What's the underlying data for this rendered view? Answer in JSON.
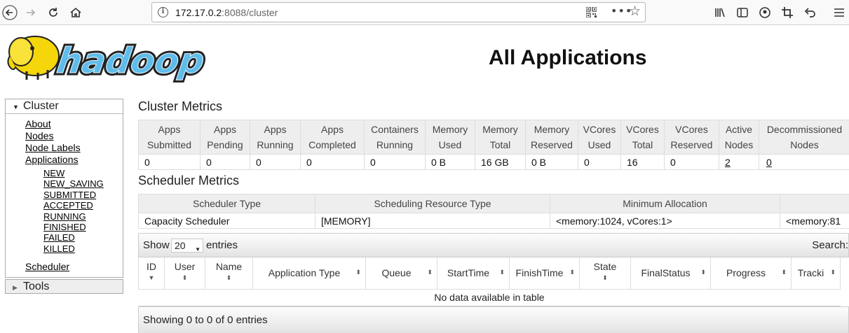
{
  "browser": {
    "url_host": "172.17.0.2",
    "url_rest": ":8088/cluster"
  },
  "page": {
    "title": "All Applications"
  },
  "sidebar": {
    "cluster_label": "Cluster",
    "links": [
      "About",
      "Nodes",
      "Node Labels",
      "Applications"
    ],
    "app_states": [
      "NEW",
      "NEW_SAVING",
      "SUBMITTED",
      "ACCEPTED",
      "RUNNING",
      "FINISHED",
      "FAILED",
      "KILLED"
    ],
    "scheduler": "Scheduler",
    "tools_label": "Tools"
  },
  "cluster_metrics": {
    "title": "Cluster Metrics",
    "headers": [
      [
        "Apps",
        "Submitted"
      ],
      [
        "Apps",
        "Pending"
      ],
      [
        "Apps",
        "Running"
      ],
      [
        "Apps",
        "Completed"
      ],
      [
        "Containers",
        "Running"
      ],
      [
        "Memory",
        "Used"
      ],
      [
        "Memory",
        "Total"
      ],
      [
        "Memory",
        "Reserved"
      ],
      [
        "VCores",
        "Used"
      ],
      [
        "VCores",
        "Total"
      ],
      [
        "VCores",
        "Reserved"
      ],
      [
        "Active",
        "Nodes"
      ],
      [
        "Decommissioned",
        "Nodes"
      ]
    ],
    "values": [
      "0",
      "0",
      "0",
      "0",
      "0",
      "0 B",
      "16 GB",
      "0 B",
      "0",
      "16",
      "0",
      "2",
      "0"
    ]
  },
  "scheduler_metrics": {
    "title": "Scheduler Metrics",
    "headers": [
      "Scheduler Type",
      "Scheduling Resource Type",
      "Minimum Allocation",
      ""
    ],
    "values": [
      "Capacity Scheduler",
      "[MEMORY]",
      "<memory:1024, vCores:1>",
      "<memory:81"
    ]
  },
  "apps_table": {
    "show_label": "Show",
    "page_size": "20",
    "entries_label": "entries",
    "search_label": "Search:",
    "columns": [
      "ID",
      "User",
      "Name",
      "Application Type",
      "Queue",
      "StartTime",
      "FinishTime",
      "State",
      "FinalStatus",
      "Progress",
      "Tracki"
    ],
    "empty_message": "No data available in table",
    "footer": "Showing 0 to 0 of 0 entries"
  }
}
